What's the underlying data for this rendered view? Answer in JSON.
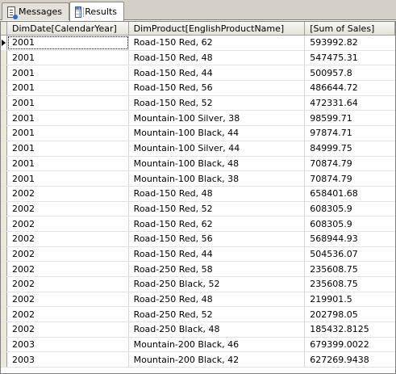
{
  "tabs": [
    {
      "label": "Messages",
      "icon": "messages-icon"
    },
    {
      "label": "Results",
      "icon": "results-grid-icon"
    }
  ],
  "grid": {
    "columns": [
      "DimDate[CalendarYear]",
      "DimProduct[EnglishProductName]",
      "[Sum of Sales]"
    ],
    "rows": [
      [
        "2001",
        "Road-150 Red, 62",
        "593992.82"
      ],
      [
        "2001",
        "Road-150 Red, 48",
        "547475.31"
      ],
      [
        "2001",
        "Road-150 Red, 44",
        "500957.8"
      ],
      [
        "2001",
        "Road-150 Red, 56",
        "486644.72"
      ],
      [
        "2001",
        "Road-150 Red, 52",
        "472331.64"
      ],
      [
        "2001",
        "Mountain-100 Silver, 38",
        "98599.71"
      ],
      [
        "2001",
        "Mountain-100 Black, 44",
        "97874.71"
      ],
      [
        "2001",
        "Mountain-100 Silver, 44",
        "84999.75"
      ],
      [
        "2001",
        "Mountain-100 Black, 48",
        "70874.79"
      ],
      [
        "2001",
        "Mountain-100 Black, 38",
        "70874.79"
      ],
      [
        "2002",
        "Road-150 Red, 48",
        "658401.68"
      ],
      [
        "2002",
        "Road-150 Red, 52",
        "608305.9"
      ],
      [
        "2002",
        "Road-150 Red, 62",
        "608305.9"
      ],
      [
        "2002",
        "Road-150 Red, 56",
        "568944.93"
      ],
      [
        "2002",
        "Road-150 Red, 44",
        "504536.07"
      ],
      [
        "2002",
        "Road-250 Red, 58",
        "235608.75"
      ],
      [
        "2002",
        "Road-250 Black, 52",
        "235608.75"
      ],
      [
        "2002",
        "Road-250 Red, 48",
        "219901.5"
      ],
      [
        "2002",
        "Road-250 Red, 52",
        "202798.05"
      ],
      [
        "2002",
        "Road-250 Black, 48",
        "185432.8125"
      ],
      [
        "2003",
        "Mountain-200 Black, 46",
        "679399.0022"
      ],
      [
        "2003",
        "Mountain-200 Black, 42",
        "627269.9438"
      ]
    ]
  }
}
